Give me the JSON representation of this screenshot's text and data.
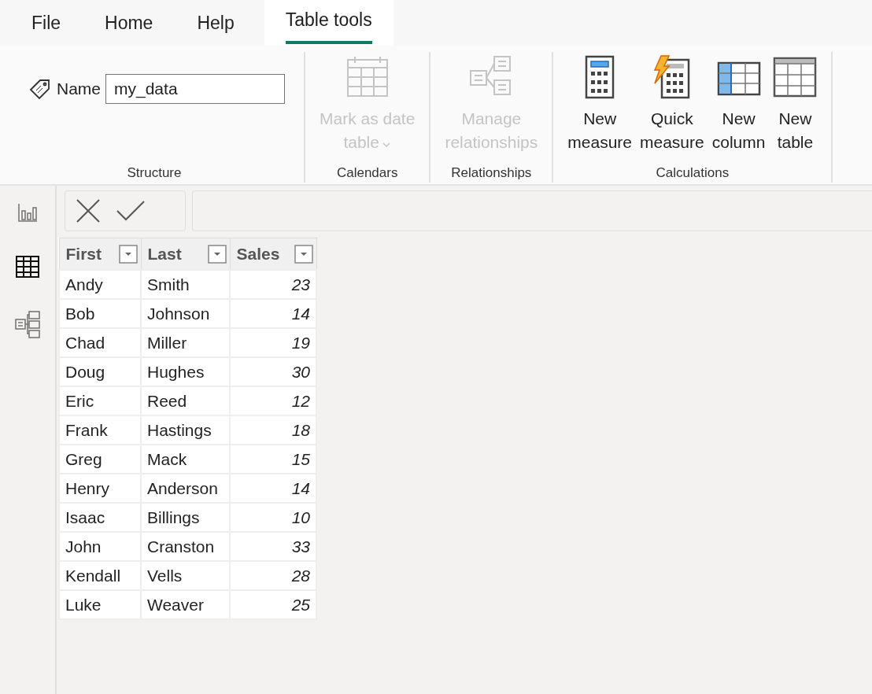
{
  "menu_tabs": [
    {
      "label": "File",
      "selected": false
    },
    {
      "label": "Home",
      "selected": false
    },
    {
      "label": "Help",
      "selected": false
    },
    {
      "label": "Table tools",
      "selected": true
    }
  ],
  "ribbon": {
    "groups": [
      {
        "label": "Structure",
        "kind": "name",
        "name_label": "Name",
        "name_value": "my_data"
      },
      {
        "label": "Calendars",
        "kind": "buttons",
        "buttons": [
          {
            "kind": "calendar",
            "lines": [
              "Mark as date",
              "table"
            ],
            "dropdown": true,
            "disabled": true
          }
        ]
      },
      {
        "label": "Relationships",
        "kind": "buttons",
        "buttons": [
          {
            "kind": "relationships",
            "lines": [
              "Manage",
              "relationships"
            ],
            "dropdown": false,
            "disabled": true
          }
        ]
      },
      {
        "label": "Calculations",
        "kind": "buttons",
        "buttons": [
          {
            "kind": "measure",
            "lines": [
              "New",
              "measure"
            ],
            "dropdown": false,
            "disabled": false
          },
          {
            "kind": "quick-measure",
            "lines": [
              "Quick",
              "measure"
            ],
            "dropdown": false,
            "disabled": false
          },
          {
            "kind": "column",
            "lines": [
              "New",
              "column"
            ],
            "dropdown": false,
            "disabled": false
          },
          {
            "kind": "table",
            "lines": [
              "New",
              "table"
            ],
            "dropdown": false,
            "disabled": false
          }
        ]
      }
    ]
  },
  "views": [
    {
      "kind": "report",
      "selected": false
    },
    {
      "kind": "data",
      "selected": true
    },
    {
      "kind": "model",
      "selected": false
    }
  ],
  "table": {
    "columns": [
      {
        "label": "First",
        "kind": "text"
      },
      {
        "label": "Last",
        "kind": "text"
      },
      {
        "label": "Sales",
        "kind": "number"
      }
    ],
    "rows": [
      [
        "Andy",
        "Smith",
        "23"
      ],
      [
        "Bob",
        "Johnson",
        "14"
      ],
      [
        "Chad",
        "Miller",
        "19"
      ],
      [
        "Doug",
        "Hughes",
        "30"
      ],
      [
        "Eric",
        "Reed",
        "12"
      ],
      [
        "Frank",
        "Hastings",
        "18"
      ],
      [
        "Greg",
        "Mack",
        "15"
      ],
      [
        "Henry",
        "Anderson",
        "14"
      ],
      [
        "Isaac",
        "Billings",
        "10"
      ],
      [
        "John",
        "Cranston",
        "33"
      ],
      [
        "Kendall",
        "Vells",
        "28"
      ],
      [
        "Luke",
        "Weaver",
        "25"
      ]
    ]
  }
}
